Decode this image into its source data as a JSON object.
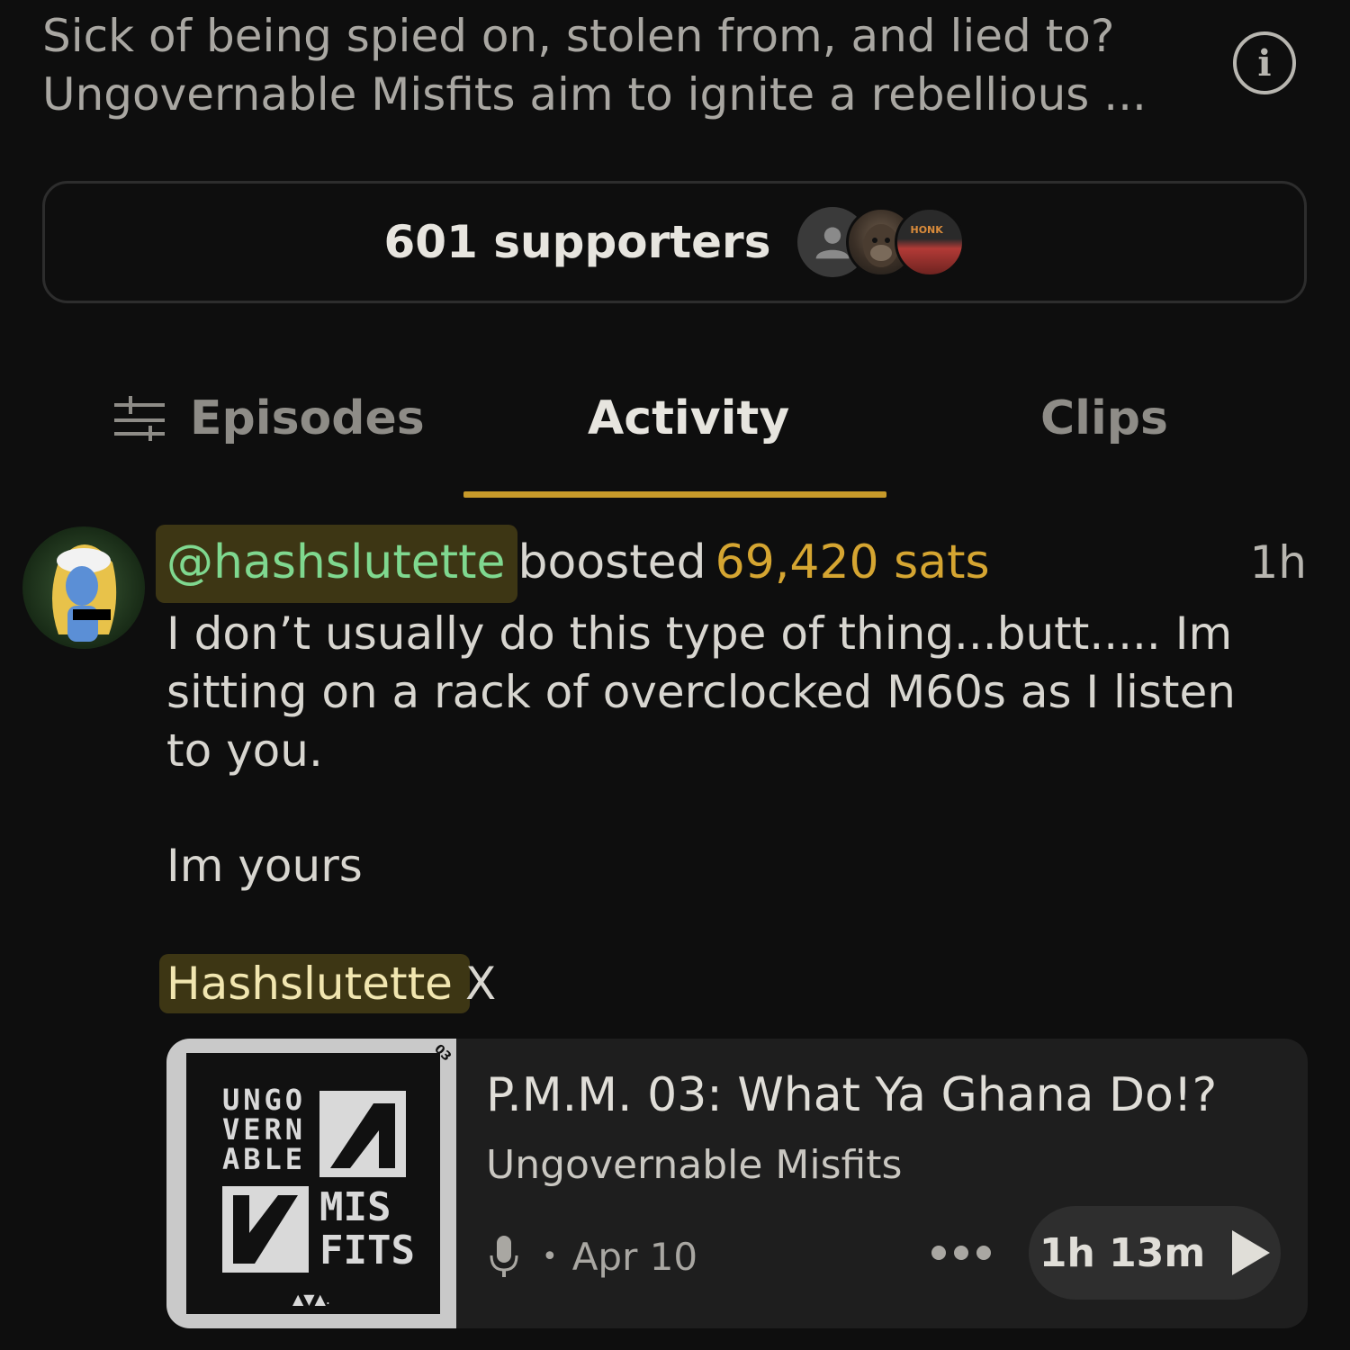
{
  "description": {
    "line1": "Sick of being spied on, stolen from, and lied to?",
    "line2": "Ungovernable Misfits aim to ignite a rebellious ..."
  },
  "info_icon": "info-icon",
  "supporters": {
    "label": "601 supporters",
    "avatars": [
      "generic-user-icon",
      "ape-avatar",
      "honk-cap-avatar"
    ],
    "honk_text": "HONK"
  },
  "tabs": [
    {
      "label": "Episodes",
      "icon": "filter-sliders-icon",
      "active": false
    },
    {
      "label": "Activity",
      "active": true
    },
    {
      "label": "Clips",
      "active": false
    }
  ],
  "accent_color": "#c79a2a",
  "activity": {
    "handle": "@hashslutette",
    "action": "boosted",
    "amount": "69,420 sats",
    "time": "1h",
    "message_line1": "I don’t usually do this type of thing...butt..... Im sitting on a rack of overclocked M60s as I listen to you.",
    "message_line2": "Im yours",
    "signature": "Hashslutette",
    "signature_suffix": "X"
  },
  "episode": {
    "title": "P.M.M. 03: What Ya Ghana Do!?",
    "show": "Ungovernable Misfits",
    "date": "Apr 10",
    "duration": "1h 13m",
    "cover": {
      "badge": "03",
      "text_top": [
        "UNGO",
        "VERN",
        "ABLE"
      ],
      "text_bottom": [
        "MIS",
        "FITS"
      ]
    }
  }
}
